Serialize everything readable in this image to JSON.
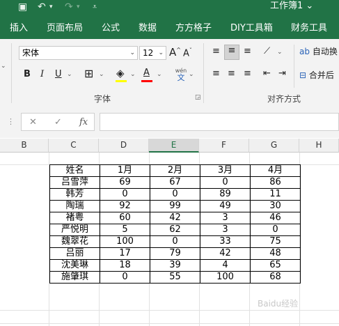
{
  "titlebar": {
    "doc_title": "工作簿1 ⌄",
    "qat": {
      "save_icon": "save-icon",
      "undo_icon": "undo-icon",
      "redo_icon": "redo-icon",
      "customize_icon": "customize-icon"
    }
  },
  "ribbon_tabs": [
    "插入",
    "页面布局",
    "公式",
    "数据",
    "方方格子",
    "DIY工具箱",
    "财务工具"
  ],
  "font_group": {
    "font_name": "宋体",
    "font_size": "12",
    "increase_label": "A",
    "decrease_label": "A",
    "bold_label": "B",
    "italic_label": "I",
    "underline_label": "U",
    "wen_label": "wén",
    "wen_char": "文",
    "font_color_label": "A",
    "group_label": "字体",
    "highlight_color": "#ffff00",
    "font_color": "#ff0000"
  },
  "align_group": {
    "group_label": "对齐方式",
    "wrap_label": "自动换",
    "merge_label": "合并后"
  },
  "formula_bar": {
    "cancel_glyph": "✕",
    "enter_glyph": "✓",
    "fx_label": "fx",
    "name_value": "",
    "formula_value": ""
  },
  "column_headers": [
    "B",
    "C",
    "D",
    "E",
    "F",
    "G",
    "H"
  ],
  "selected_column": "E",
  "table": {
    "header": [
      "姓名",
      "1月",
      "2月",
      "3月",
      "4月"
    ],
    "rows": [
      [
        "吕雪萍",
        "69",
        "67",
        "0",
        "86"
      ],
      [
        "韩芳",
        "0",
        "0",
        "89",
        "11"
      ],
      [
        "陶瑞",
        "92",
        "99",
        "49",
        "30"
      ],
      [
        "褚粤",
        "60",
        "42",
        "3",
        "46"
      ],
      [
        "严悦明",
        "5",
        "62",
        "3",
        "0"
      ],
      [
        "魏翠花",
        "100",
        "0",
        "33",
        "75"
      ],
      [
        "吕丽",
        "17",
        "79",
        "42",
        "48"
      ],
      [
        "沈美琳",
        "18",
        "39",
        "4",
        "65"
      ],
      [
        "施肇琪",
        "0",
        "55",
        "100",
        "68"
      ]
    ]
  },
  "watermark": "Baidu经验"
}
